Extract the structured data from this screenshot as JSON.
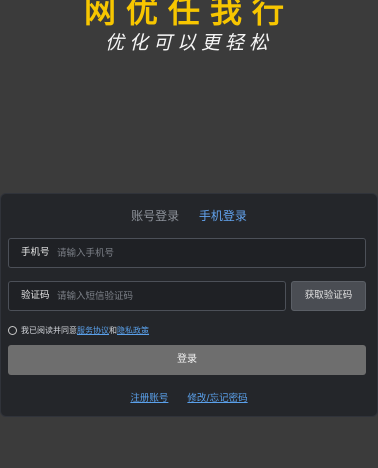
{
  "header": {
    "title": "网优任我行",
    "slogan": "优化可以更轻松",
    "title_color": "#f7c600",
    "slogan_color": "#f5f5f5"
  },
  "login": {
    "tabs": [
      {
        "label": "账号登录",
        "active": false
      },
      {
        "label": "手机登录",
        "active": true
      }
    ],
    "phone": {
      "label": "手机号",
      "placeholder": "请输入手机号"
    },
    "code": {
      "label": "验证码",
      "placeholder": "请输入短信验证码"
    },
    "get_code_label": "获取验证码",
    "agreement": {
      "prefix": "我已阅读并同意",
      "service_link": "服务协议",
      "and": "和",
      "privacy_link": "隐私政策"
    },
    "submit_label": "登录",
    "register_link": "注册账号",
    "forgot_link": "修改/忘记密码",
    "accent_color": "#62a3ee"
  }
}
